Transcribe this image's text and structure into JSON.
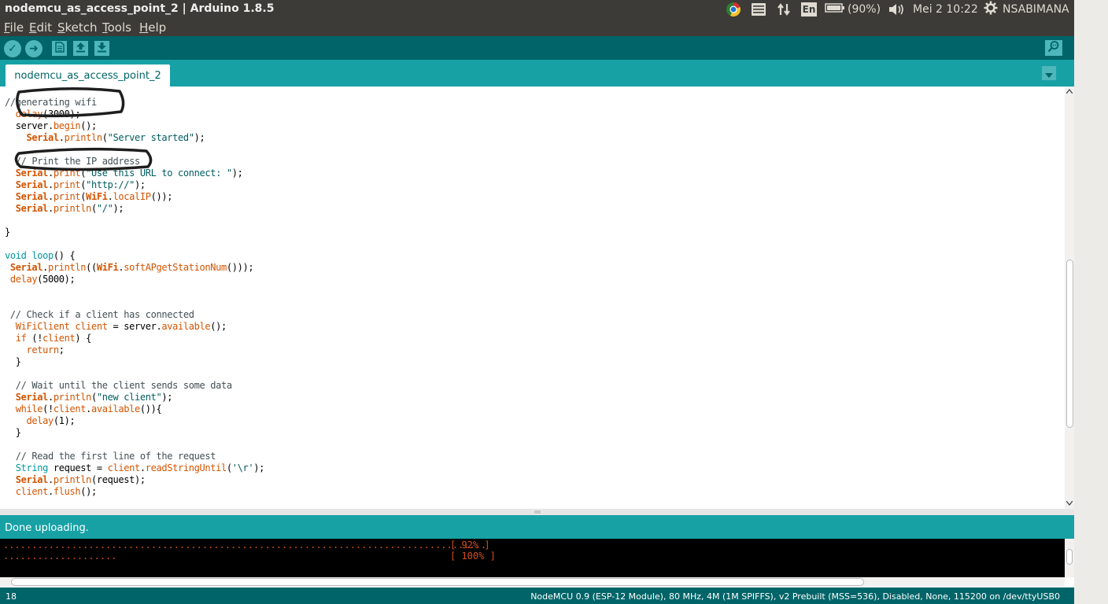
{
  "window": {
    "title": "nodemcu_as_access_point_2 | Arduino 1.8.5"
  },
  "system_tray": {
    "battery": "(90%)",
    "clock": "Mei  2 10:22",
    "keyboard_layout": "En",
    "user": "NSABIMANA"
  },
  "menu": {
    "items": [
      {
        "accel": "F",
        "rest": "ile"
      },
      {
        "accel": "E",
        "rest": "dit"
      },
      {
        "accel": "S",
        "rest": "ketch"
      },
      {
        "accel": "T",
        "rest": "ools"
      },
      {
        "accel": "H",
        "rest": "elp"
      }
    ]
  },
  "toolbar": {
    "verify_glyph": "✓",
    "upload_glyph": "➜"
  },
  "tabs": [
    {
      "label": "nodemcu_as_access_point_2"
    }
  ],
  "editor": {
    "lines": [
      {
        "t": [
          [
            "cm",
            "//generating wifi"
          ]
        ]
      },
      {
        "t": [
          [
            "",
            "  "
          ],
          [
            "kw",
            "delay"
          ],
          [
            "",
            "(3000);"
          ]
        ]
      },
      {
        "t": [
          [
            "",
            "  server."
          ],
          [
            "kw",
            "begin"
          ],
          [
            "",
            "();"
          ]
        ]
      },
      {
        "t": [
          [
            "",
            "    "
          ],
          [
            "kwb",
            "Serial"
          ],
          [
            "",
            "."
          ],
          [
            "kw",
            "println"
          ],
          [
            "",
            "("
          ],
          [
            "st",
            "\"Server started\""
          ],
          [
            "",
            ");"
          ]
        ]
      },
      {
        "t": []
      },
      {
        "t": [
          [
            "cm",
            "  // Print the IP address"
          ]
        ]
      },
      {
        "t": [
          [
            "",
            "  "
          ],
          [
            "kwb",
            "Serial"
          ],
          [
            "",
            "."
          ],
          [
            "kw",
            "print"
          ],
          [
            "",
            "("
          ],
          [
            "st",
            "\"Use this URL to connect: \""
          ],
          [
            "",
            ");"
          ]
        ]
      },
      {
        "t": [
          [
            "",
            "  "
          ],
          [
            "kwb",
            "Serial"
          ],
          [
            "",
            "."
          ],
          [
            "kw",
            "print"
          ],
          [
            "",
            "("
          ],
          [
            "st",
            "\"http://\""
          ],
          [
            "",
            ");"
          ]
        ]
      },
      {
        "t": [
          [
            "",
            "  "
          ],
          [
            "kwb",
            "Serial"
          ],
          [
            "",
            "."
          ],
          [
            "kw",
            "print"
          ],
          [
            "",
            "("
          ],
          [
            "kwb",
            "WiFi"
          ],
          [
            "",
            "."
          ],
          [
            "kw",
            "localIP"
          ],
          [
            "",
            "());"
          ]
        ]
      },
      {
        "t": [
          [
            "",
            "  "
          ],
          [
            "kwb",
            "Serial"
          ],
          [
            "",
            "."
          ],
          [
            "kw",
            "println"
          ],
          [
            "",
            "("
          ],
          [
            "st",
            "\"/\""
          ],
          [
            "",
            ");"
          ]
        ]
      },
      {
        "t": []
      },
      {
        "t": [
          [
            "",
            "}"
          ]
        ]
      },
      {
        "t": []
      },
      {
        "t": [
          [
            "ty",
            "void"
          ],
          [
            "",
            " "
          ],
          [
            "ty",
            "loop"
          ],
          [
            "",
            "() {"
          ]
        ]
      },
      {
        "t": [
          [
            "",
            " "
          ],
          [
            "kwb",
            "Serial"
          ],
          [
            "",
            "."
          ],
          [
            "kw",
            "println"
          ],
          [
            "",
            "(("
          ],
          [
            "kwb",
            "WiFi"
          ],
          [
            "",
            "."
          ],
          [
            "kw",
            "softAPgetStationNum"
          ],
          [
            "",
            "()));"
          ]
        ]
      },
      {
        "t": [
          [
            "",
            " "
          ],
          [
            "kw",
            "delay"
          ],
          [
            "",
            "(5000);"
          ]
        ]
      },
      {
        "t": []
      },
      {
        "t": []
      },
      {
        "t": [
          [
            "cm",
            " // Check if a client has connected"
          ]
        ]
      },
      {
        "t": [
          [
            "",
            "  "
          ],
          [
            "kw",
            "WiFiClient"
          ],
          [
            "",
            " "
          ],
          [
            "kw",
            "client"
          ],
          [
            "",
            " = server."
          ],
          [
            "kw",
            "available"
          ],
          [
            "",
            "();"
          ]
        ]
      },
      {
        "t": [
          [
            "",
            "  "
          ],
          [
            "kw",
            "if"
          ],
          [
            "",
            " (!"
          ],
          [
            "kw",
            "client"
          ],
          [
            "",
            ") {"
          ]
        ]
      },
      {
        "t": [
          [
            "",
            "    "
          ],
          [
            "kw",
            "return"
          ],
          [
            "",
            ";"
          ]
        ]
      },
      {
        "t": [
          [
            "",
            "  }"
          ]
        ]
      },
      {
        "t": []
      },
      {
        "t": [
          [
            "cm",
            "  // Wait until the client sends some data"
          ]
        ]
      },
      {
        "t": [
          [
            "",
            "  "
          ],
          [
            "kwb",
            "Serial"
          ],
          [
            "",
            "."
          ],
          [
            "kw",
            "println"
          ],
          [
            "",
            "("
          ],
          [
            "st",
            "\"new client\""
          ],
          [
            "",
            ");"
          ]
        ]
      },
      {
        "t": [
          [
            "",
            "  "
          ],
          [
            "kw",
            "while"
          ],
          [
            "",
            "(!"
          ],
          [
            "kw",
            "client"
          ],
          [
            "",
            "."
          ],
          [
            "kw",
            "available"
          ],
          [
            "",
            "()){"
          ]
        ]
      },
      {
        "t": [
          [
            "",
            "    "
          ],
          [
            "kw",
            "delay"
          ],
          [
            "",
            "(1);"
          ]
        ]
      },
      {
        "t": [
          [
            "",
            "  }"
          ]
        ]
      },
      {
        "t": []
      },
      {
        "t": [
          [
            "cm",
            "  // Read the first line of the request"
          ]
        ]
      },
      {
        "t": [
          [
            "",
            "  "
          ],
          [
            "ty",
            "String"
          ],
          [
            "",
            " request = "
          ],
          [
            "kw",
            "client"
          ],
          [
            "",
            "."
          ],
          [
            "kw",
            "readStringUntil"
          ],
          [
            "",
            "("
          ],
          [
            "st",
            "'\\r'"
          ],
          [
            "",
            ");"
          ]
        ]
      },
      {
        "t": [
          [
            "",
            "  "
          ],
          [
            "kwb",
            "Serial"
          ],
          [
            "",
            "."
          ],
          [
            "kw",
            "println"
          ],
          [
            "",
            "(request);"
          ]
        ]
      },
      {
        "t": [
          [
            "",
            "  "
          ],
          [
            "kw",
            "client"
          ],
          [
            "",
            "."
          ],
          [
            "kw",
            "flush"
          ],
          [
            "",
            "();"
          ]
        ]
      }
    ]
  },
  "status": {
    "message": "Done uploading."
  },
  "console": {
    "lines": [
      {
        "dots": ".....................................................................................",
        "progress": "[ 92% ]"
      },
      {
        "dots": "....................",
        "progress": "[ 100% ]"
      }
    ]
  },
  "footer": {
    "line_number": "18",
    "board_info": "NodeMCU 0.9 (ESP-12 Module), 80 MHz, 4M (1M SPIFFS), v2 Prebuilt (MSS=536), Disabled, None, 115200 on /dev/ttyUSB0"
  },
  "colors": {
    "toolbar": "#006468",
    "tab_bar": "#17a1a5",
    "button": "#4db7bb",
    "keyword": "#d35400",
    "type": "#00979c",
    "console_text": "#d34f1c"
  },
  "icons": [
    "chrome-icon",
    "indicator-menu-icon",
    "network-arrows-icon",
    "keyboard-layout-icon",
    "battery-icon",
    "volume-icon",
    "settings-gear-icon",
    "verify-check-icon",
    "upload-arrow-icon",
    "new-file-icon",
    "open-arrow-up-icon",
    "save-arrow-down-icon",
    "serial-monitor-icon",
    "tab-menu-chevron-icon"
  ]
}
